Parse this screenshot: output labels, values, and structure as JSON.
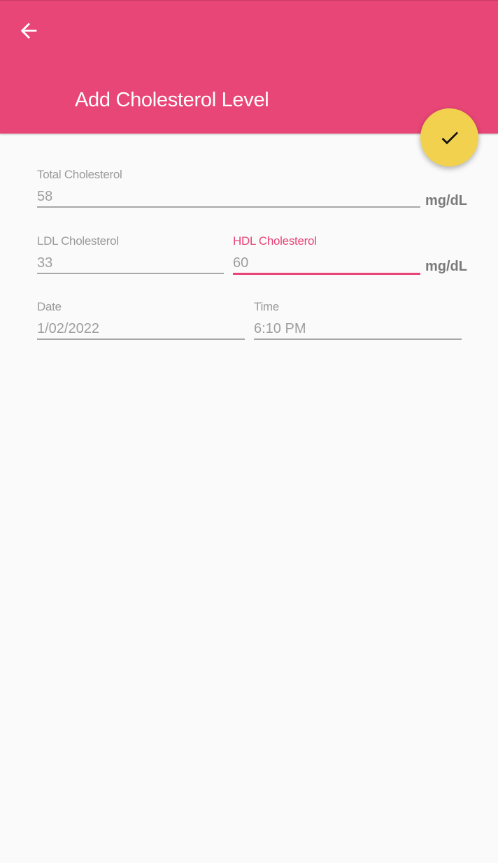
{
  "appbar": {
    "title": "Add Cholesterol Level",
    "back_icon": "arrow-left-icon",
    "color": "#e84677"
  },
  "fab": {
    "icon": "check-icon",
    "color": "#f2d14e"
  },
  "form": {
    "total": {
      "label": "Total Cholesterol",
      "value": "58",
      "unit": "mg/dL"
    },
    "ldl": {
      "label": "LDL Cholesterol",
      "value": "33"
    },
    "hdl": {
      "label": "HDL Cholesterol",
      "value": "60",
      "unit": "mg/dL"
    },
    "date": {
      "label": "Date",
      "value": "1/02/2022"
    },
    "time": {
      "label": "Time",
      "value": "6:10 PM"
    }
  }
}
